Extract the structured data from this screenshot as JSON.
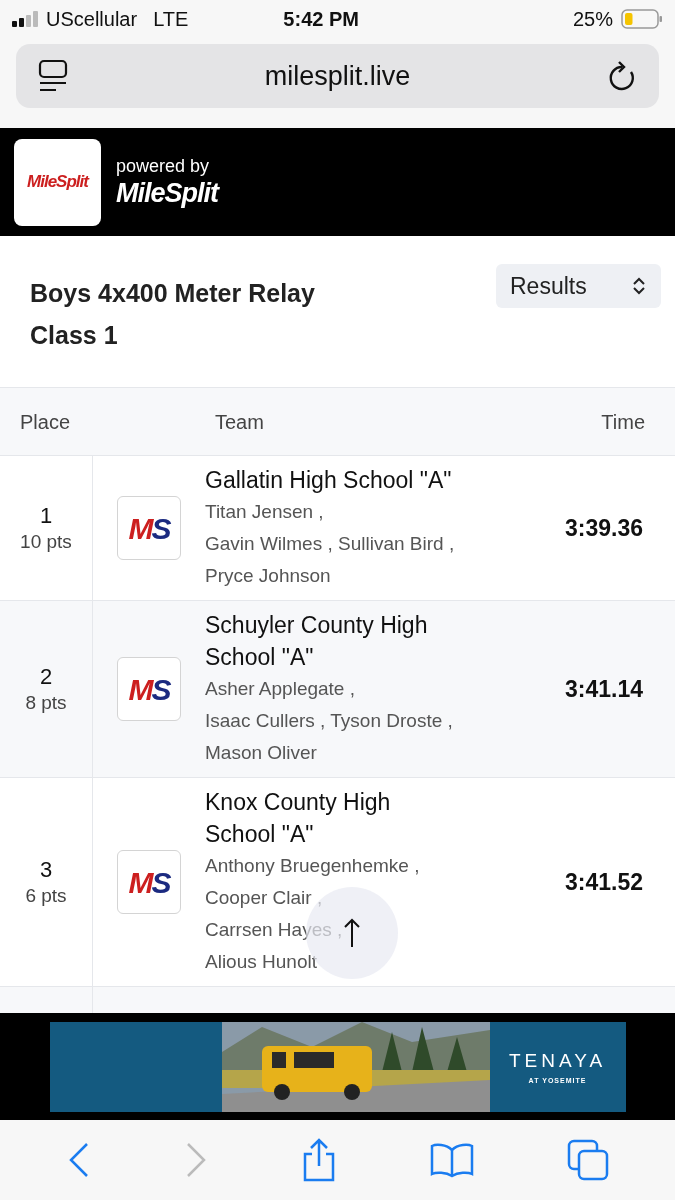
{
  "status_bar": {
    "carrier": "UScellular",
    "network": "LTE",
    "time": "5:42 PM",
    "battery": "25%"
  },
  "address_bar": {
    "url": "milesplit.live"
  },
  "header": {
    "logo": "MileSplit",
    "powered_by": "powered by",
    "brand": "MileSplit"
  },
  "event": {
    "title": "Boys 4x400 Meter Relay",
    "subtitle": "Class 1",
    "view_select": "Results"
  },
  "table": {
    "columns": [
      "Place",
      "Team",
      "Time"
    ],
    "rows": [
      {
        "place": "1",
        "points": "10 pts",
        "logo": "MS",
        "team": "Gallatin High School \"A\"",
        "athlete_lines": [
          "Titan Jensen ,",
          "Gavin Wilmes , Sullivan Bird ,",
          "Pryce Johnson"
        ],
        "time": "3:39.36"
      },
      {
        "place": "2",
        "points": "8 pts",
        "logo": "MS",
        "team": "Schuyler County High School \"A\"",
        "athlete_lines": [
          "Asher Applegate ,",
          "Isaac Cullers , Tyson Droste ,",
          "Mason Oliver"
        ],
        "time": "3:41.14"
      },
      {
        "place": "3",
        "points": "6 pts",
        "logo": "MS",
        "team": "Knox County High School \"A\"",
        "athlete_lines": [
          "Anthony Bruegenhemke ,",
          "Cooper Clair ,",
          "Carrsen Hayes ,",
          "Alious Hunolt"
        ],
        "time": "3:41.52"
      },
      {}
    ]
  },
  "ad": {
    "brand": "TENAYA",
    "tagline": "AT YOSEMITE"
  },
  "toolbar": {
    "back_disabled": false,
    "forward_disabled": true
  }
}
